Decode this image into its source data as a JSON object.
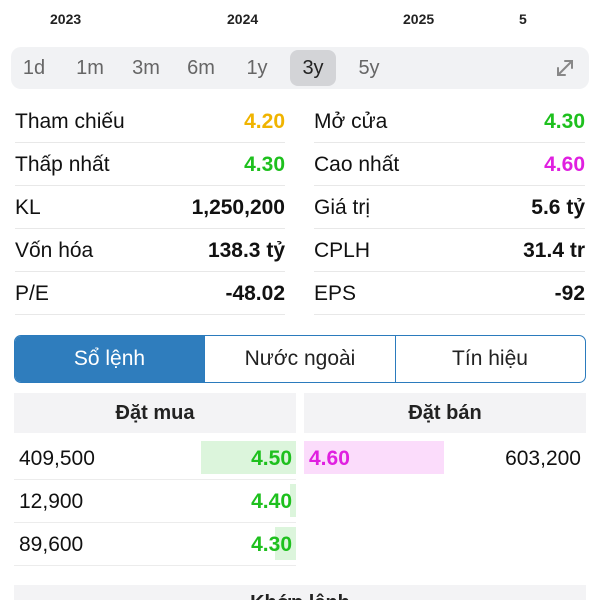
{
  "timeline": {
    "years": [
      "2023",
      "2024",
      "2025",
      "5"
    ]
  },
  "ranges": {
    "items": [
      "1d",
      "1m",
      "3m",
      "6m",
      "1y",
      "3y",
      "5y"
    ],
    "active": "3y"
  },
  "stats": {
    "rows": [
      {
        "left_label": "Tham chiếu",
        "left_value": "4.20",
        "right_label": "Mở cửa",
        "right_value": "4.30"
      },
      {
        "left_label": "Thấp nhất",
        "left_value": "4.30",
        "right_label": "Cao nhất",
        "right_value": "4.60"
      },
      {
        "left_label": "KL",
        "left_value": "1,250,200",
        "right_label": "Giá trị",
        "right_value": "5.6 tỷ"
      },
      {
        "left_label": "Vốn hóa",
        "left_value": "138.3 tỷ",
        "right_label": "CPLH",
        "right_value": "31.4 tr"
      },
      {
        "left_label": "P/E",
        "left_value": "-48.02",
        "right_label": "EPS",
        "right_value": "-92"
      }
    ]
  },
  "colors": {
    "reference": "#f0b400",
    "up": "#1ec01e",
    "ceiling": "#e020e0",
    "accent": "#2f7dbd"
  },
  "tabs": {
    "items": [
      "Sổ lệnh",
      "Nước ngoài",
      "Tín hiệu"
    ],
    "active": "Sổ lệnh"
  },
  "orderbook": {
    "bid_title": "Đặt mua",
    "ask_title": "Đặt bán",
    "bids": [
      {
        "qty": "409,500",
        "price": "4.50",
        "depth": 1.0
      },
      {
        "qty": "12,900",
        "price": "4.40",
        "depth": 0.03
      },
      {
        "qty": "89,600",
        "price": "4.30",
        "depth": 0.22
      }
    ],
    "asks": [
      {
        "qty": "603,200",
        "price": "4.60",
        "depth": 1.0
      }
    ]
  },
  "footer": {
    "title": "Khớp lệnh"
  }
}
